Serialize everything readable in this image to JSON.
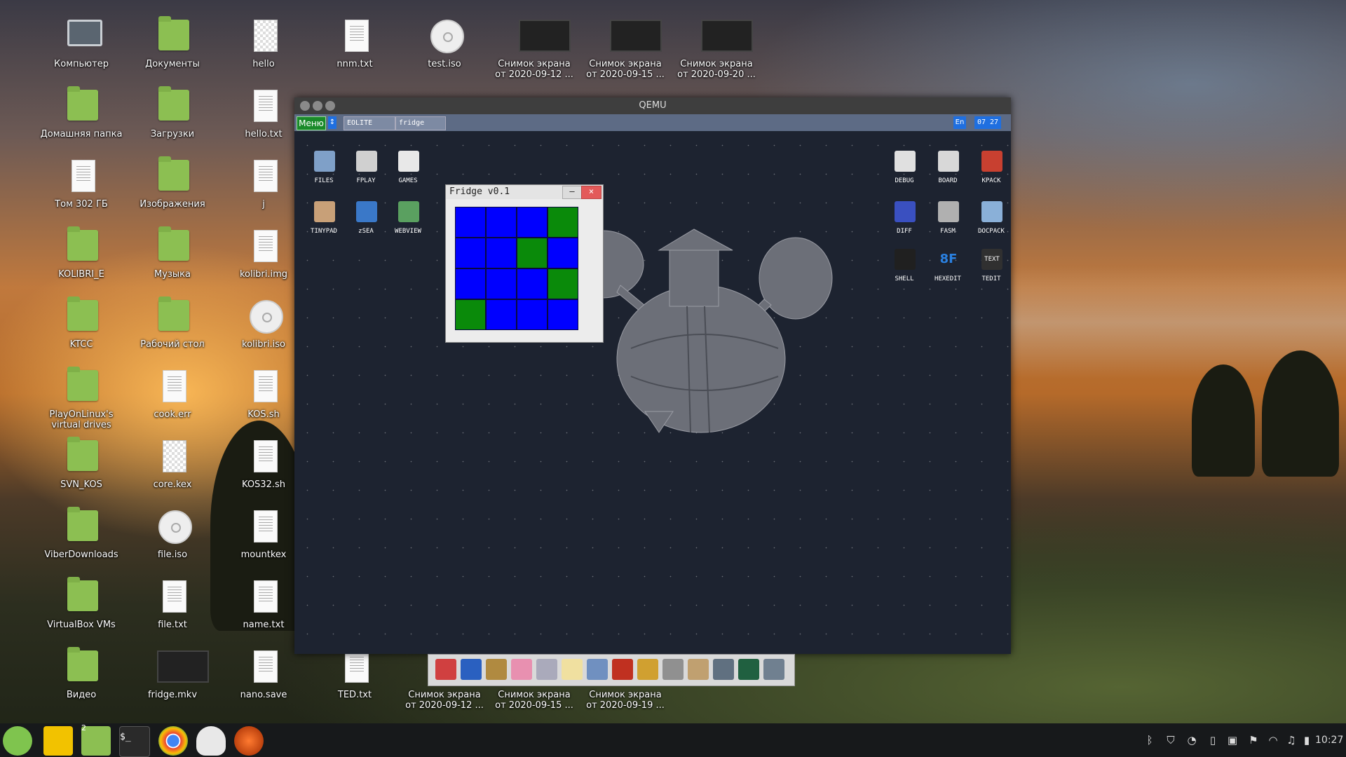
{
  "desktop": {
    "icons": [
      {
        "label": "Компьютер",
        "kind": "monitor"
      },
      {
        "label": "Документы",
        "kind": "folder"
      },
      {
        "label": "hello",
        "kind": "checker"
      },
      {
        "label": "nnm.txt",
        "kind": "doc"
      },
      {
        "label": "test.iso",
        "kind": "disc"
      },
      {
        "label": "Снимок экрана от 2020-09-12 ...",
        "kind": "shot"
      },
      {
        "label": "Снимок экрана от 2020-09-15 ...",
        "kind": "shot"
      },
      {
        "label": "Снимок экрана от 2020-09-20 ...",
        "kind": "shot"
      },
      {
        "label": "Домашняя папка",
        "kind": "folder"
      },
      {
        "label": "Загрузки",
        "kind": "folder"
      },
      {
        "label": "hello.txt",
        "kind": "doc"
      },
      {
        "label": "Том 302 ГБ",
        "kind": "drive"
      },
      {
        "label": "Изображения",
        "kind": "folder"
      },
      {
        "label": "j",
        "kind": "doc"
      },
      {
        "label": "KOLIBRI_E",
        "kind": "folder"
      },
      {
        "label": "Музыка",
        "kind": "folder"
      },
      {
        "label": "kolibri.img",
        "kind": "doc"
      },
      {
        "label": "KTCC",
        "kind": "folder"
      },
      {
        "label": "Рабочий стол",
        "kind": "folder"
      },
      {
        "label": "kolibri.iso",
        "kind": "disc"
      },
      {
        "label": "PlayOnLinux's virtual drives",
        "kind": "folder"
      },
      {
        "label": "cook.err",
        "kind": "doc"
      },
      {
        "label": "KOS.sh",
        "kind": "doc"
      },
      {
        "label": "SVN_KOS",
        "kind": "folder"
      },
      {
        "label": "core.kex",
        "kind": "checker"
      },
      {
        "label": "KOS32.sh",
        "kind": "doc"
      },
      {
        "label": "ViberDownloads",
        "kind": "folder"
      },
      {
        "label": "file.iso",
        "kind": "disc"
      },
      {
        "label": "mountkex",
        "kind": "doc"
      },
      {
        "label": "VirtualBox VMs",
        "kind": "folder"
      },
      {
        "label": "file.txt",
        "kind": "doc"
      },
      {
        "label": "name.txt",
        "kind": "doc"
      },
      {
        "label": "Видео",
        "kind": "folder"
      },
      {
        "label": "fridge.mkv",
        "kind": "shot"
      },
      {
        "label": "nano.save",
        "kind": "doc"
      },
      {
        "label": "TED.txt",
        "kind": "doc"
      },
      {
        "label": "Снимок экрана от 2020-09-12 ...",
        "kind": "shot"
      },
      {
        "label": "Снимок экрана от 2020-09-15 ...",
        "kind": "shot"
      },
      {
        "label": "Снимок экрана от 2020-09-19 ...",
        "kind": "shot"
      }
    ]
  },
  "qemu": {
    "title": "QEMU",
    "taskbar": {
      "menu": "Меню",
      "arrows": "↕",
      "tasks": [
        "EOLITE",
        "fridge"
      ],
      "lang": "En",
      "clock": "07 27"
    },
    "left_icons": [
      {
        "label": "FILES",
        "color": "#7fa0c8"
      },
      {
        "label": "FPLAY",
        "color": "#d0d0d0"
      },
      {
        "label": "GAMES",
        "color": "#e8e8e8"
      },
      {
        "label": "TINYPAD",
        "color": "#c8a078"
      },
      {
        "label": "zSEA",
        "color": "#3a78c8"
      },
      {
        "label": "WEBVIEW",
        "color": "#5aa060"
      }
    ],
    "right_icons": [
      {
        "label": "DEBUG",
        "color": "#e0e0e0"
      },
      {
        "label": "BOARD",
        "color": "#d8d8d8"
      },
      {
        "label": "KPACK",
        "color": "#c84030"
      },
      {
        "label": "DIFF",
        "color": "#3a50c0"
      },
      {
        "label": "FASM",
        "color": "#b0b0b0"
      },
      {
        "label": "DOCPACK",
        "color": "#8ab0d8"
      },
      {
        "label": "SHELL",
        "color": "#202020"
      },
      {
        "label": "HEXEDIT",
        "color": "#2a80e0"
      },
      {
        "label": "TEDIT",
        "color": "#303030"
      }
    ],
    "hexedit_glyph": "8F",
    "tedit_glyph": "TEXT",
    "fridge": {
      "title": "Fridge v0.1",
      "minimize": "–",
      "close": "×",
      "grid": [
        [
          "blue",
          "blue",
          "blue",
          "green"
        ],
        [
          "blue",
          "blue",
          "green",
          "blue"
        ],
        [
          "blue",
          "blue",
          "blue",
          "green"
        ],
        [
          "green",
          "blue",
          "blue",
          "blue"
        ]
      ],
      "colors": {
        "blue": "#0000ff",
        "green": "#0a8a0a"
      }
    },
    "dock_icons": [
      "cube-icon",
      "calendar-icon",
      "speaker-icon",
      "eraser-icon",
      "calculator-icon",
      "notepad-icon",
      "rio-icon",
      "fb2-icon",
      "tools-icon",
      "printer-icon",
      "volume-icon",
      "network-icon",
      "monitor-icon",
      "settings-icon"
    ]
  },
  "panel": {
    "launchers": [
      "mint-menu",
      "yandex",
      "files",
      "terminal",
      "chrome",
      "inkscape",
      "qemu-app"
    ],
    "files_badge": "2",
    "clock": "10:27"
  }
}
